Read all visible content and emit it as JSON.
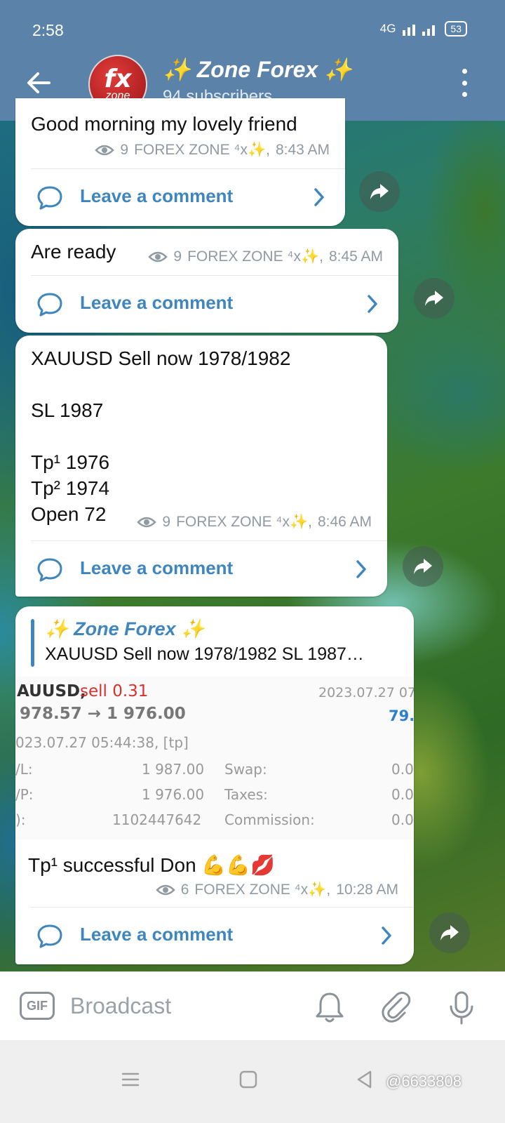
{
  "status_bar": {
    "time": "2:58",
    "network": "4G",
    "battery": "53"
  },
  "header": {
    "avatar_text_main": "fx",
    "avatar_text_sub": "zone",
    "title": "✨ Zone Forex ✨",
    "subtitle": "94 subscribers"
  },
  "messages": [
    {
      "text": "Good morning my lovely friend",
      "views": "9",
      "author": "FOREX ZONE ⁴x✨,",
      "time": "8:43 AM",
      "comment_label": "Leave a comment"
    },
    {
      "text": "Are ready",
      "views": "9",
      "author": "FOREX ZONE ⁴x✨,",
      "time": "8:45 AM",
      "comment_label": "Leave a comment"
    },
    {
      "text": "XAUUSD Sell now 1978/1982\n\nSL 1987\n\nTp¹ 1976\nTp² 1974\nOpen 72",
      "views": "9",
      "author": "FOREX ZONE ⁴x✨,",
      "time": "8:46 AM",
      "comment_label": "Leave a comment"
    },
    {
      "quote_title": "✨ Zone Forex ✨",
      "quote_text": "XAUUSD Sell now 1978/1982  SL 1987…",
      "trade": {
        "symbol": "AUUSD,",
        "action": "sell 0.31",
        "date_top": "2023.07.27 07:",
        "prices": "978.57 → 1 976.00",
        "profit": "79.(",
        "closed": "023.07.27 05:44:38, [tp]",
        "rows": [
          {
            "label": "/L:",
            "value": "1 987.00",
            "label2": "Swap:",
            "value2": "0.0"
          },
          {
            "label": "/P:",
            "value": "1 976.00",
            "label2": "Taxes:",
            "value2": "0.0"
          },
          {
            "label": "):",
            "value": "1102447642",
            "label2": "Commission:",
            "value2": "0.0"
          }
        ]
      },
      "text": "Tp¹ successful Don 💪💪💋",
      "views": "6",
      "author": "FOREX ZONE ⁴x✨,",
      "time": "10:28 AM",
      "comment_label": "Leave a comment"
    }
  ],
  "input_bar": {
    "gif_label": "GIF",
    "placeholder": "Broadcast"
  },
  "watermark": "@6633808",
  "colors": {
    "header": "#5b82a8",
    "link": "#3f86be",
    "sell": "#d9302c",
    "profit": "#2c7fd0"
  }
}
